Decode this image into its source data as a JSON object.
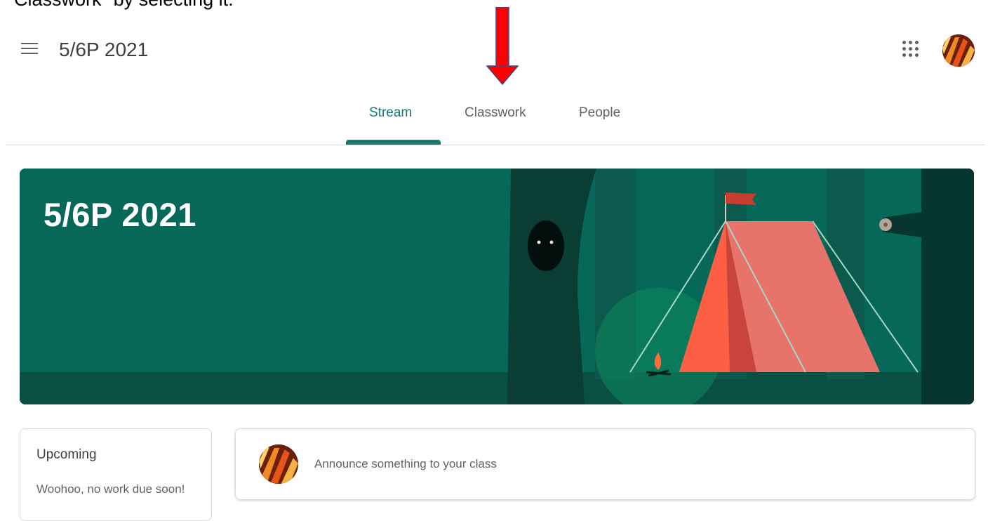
{
  "caption": "Classwork\" by selecting it.",
  "header": {
    "class_name": "5/6P 2021"
  },
  "tabs": [
    {
      "label": "Stream",
      "active": true
    },
    {
      "label": "Classwork",
      "active": false
    },
    {
      "label": "People",
      "active": false
    }
  ],
  "banner": {
    "title": "5/6P 2021"
  },
  "upcoming": {
    "title": "Upcoming",
    "note": "Woohoo, no work due soon!"
  },
  "announce": {
    "placeholder": "Announce something to your class"
  },
  "colors": {
    "accent": "#137b70",
    "banner_bg": "#066858",
    "arrow": "#ff0000"
  },
  "icons": [
    "menu-icon",
    "apps-icon",
    "avatar",
    "down-arrow"
  ]
}
